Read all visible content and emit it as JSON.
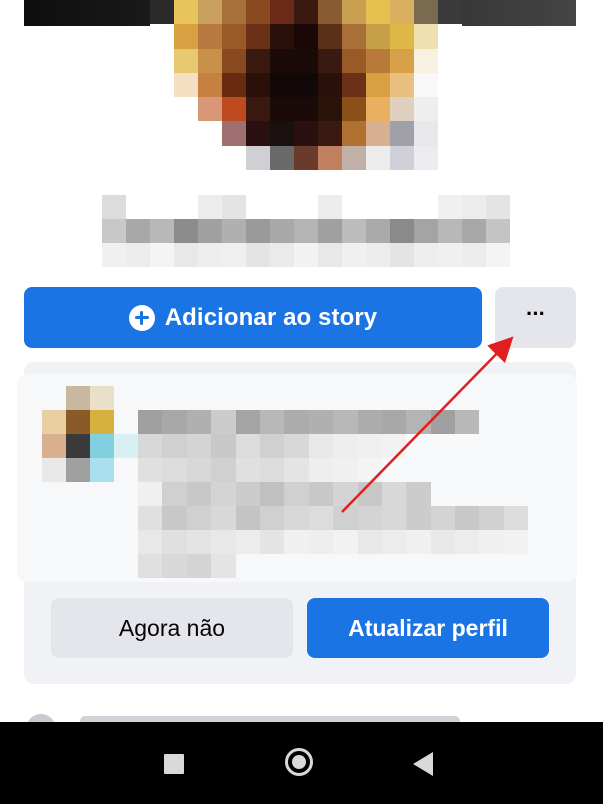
{
  "profile": {
    "story_button_label": "Adicionar ao story",
    "more_button_label": "···"
  },
  "card": {
    "secondary_button_label": "Agora não",
    "primary_button_label": "Atualizar perfil"
  },
  "colors": {
    "brand_blue": "#1b74e4",
    "secondary_gray": "#e4e6eb",
    "annotation_red": "#e02020"
  },
  "icons": {
    "story_add": "plus-circle-icon",
    "more": "ellipsis-icon",
    "nav_recents": "square-icon",
    "nav_home": "circle-icon",
    "nav_back": "triangle-back-icon"
  }
}
